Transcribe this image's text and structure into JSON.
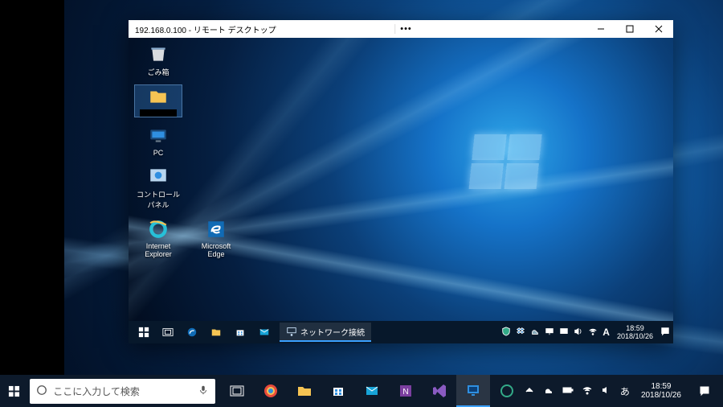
{
  "rdp": {
    "title": "192.168.0.100 - リモート デスクトップ",
    "zoom_icon": "zoom-icon",
    "more_icon": "more-icon",
    "desktop_icons": [
      {
        "name": "recycle-bin-icon",
        "label": "ごみ箱"
      },
      {
        "name": "folder-icon",
        "label": ""
      },
      {
        "name": "pc-icon",
        "label": "PC"
      },
      {
        "name": "control-panel-icon",
        "label": "コントロール パネル"
      }
    ],
    "desktop_icons_row2": [
      {
        "name": "ie-icon",
        "label": "Internet Explorer"
      },
      {
        "name": "edge-icon",
        "label": "Microsoft Edge"
      }
    ],
    "taskbar": {
      "start": "start-icon",
      "taskview": "taskview-icon",
      "pinned": [
        {
          "name": "edge-icon"
        },
        {
          "name": "explorer-icon"
        },
        {
          "name": "store-icon"
        },
        {
          "name": "mail-icon"
        }
      ],
      "running": {
        "icon": "network-icon",
        "label": "ネットワーク接続"
      },
      "tray": {
        "items": [
          "tray-shield-icon",
          "tray-dropbox-icon",
          "tray-onedrive-icon",
          "tray-network-icon",
          "tray-monitor-icon",
          "tray-volume-icon",
          "tray-wifi-icon"
        ],
        "ime": "A",
        "time": "18:59",
        "date": "2018/10/26"
      }
    }
  },
  "host": {
    "search_placeholder": "ここに入力して検索",
    "task_buttons": [
      {
        "name": "taskview-icon"
      },
      {
        "name": "chrome-icon"
      },
      {
        "name": "explorer-icon"
      },
      {
        "name": "store-icon"
      },
      {
        "name": "mail-icon"
      },
      {
        "name": "onenote-icon"
      },
      {
        "name": "visualstudio-icon"
      },
      {
        "name": "remote-desktop-icon",
        "active": true
      },
      {
        "name": "misc-icon"
      }
    ],
    "tray": {
      "items": [
        "chevron-up-icon",
        "onedrive-icon",
        "battery-icon",
        "wifi-icon",
        "volume-icon",
        "ime-icon"
      ],
      "time": "18:59",
      "date": "2018/10/26"
    }
  }
}
